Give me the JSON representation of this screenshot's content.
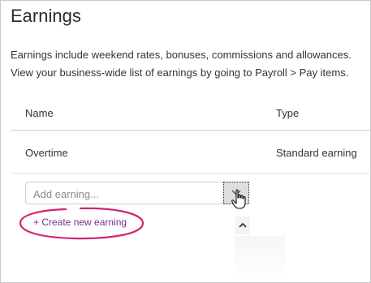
{
  "page": {
    "title": "Earnings",
    "description_line1": "Earnings include weekend rates, bonuses, commissions and allowances.",
    "description_line2": "View your business-wide list of earnings by going to Payroll > Pay items."
  },
  "table": {
    "headers": [
      "Name",
      "Type"
    ],
    "rows": [
      {
        "name": "Overtime",
        "type": "Standard earning"
      }
    ]
  },
  "add_earning": {
    "placeholder": "Add earning...",
    "dropdown_icon": "chevron-down-icon",
    "create_link_label": "+ Create new earning",
    "scroll_icon": "chevron-up-icon"
  },
  "colors": {
    "link": "#7b2d8e",
    "highlight": "#d4246e",
    "border": "#cfcfcf"
  }
}
